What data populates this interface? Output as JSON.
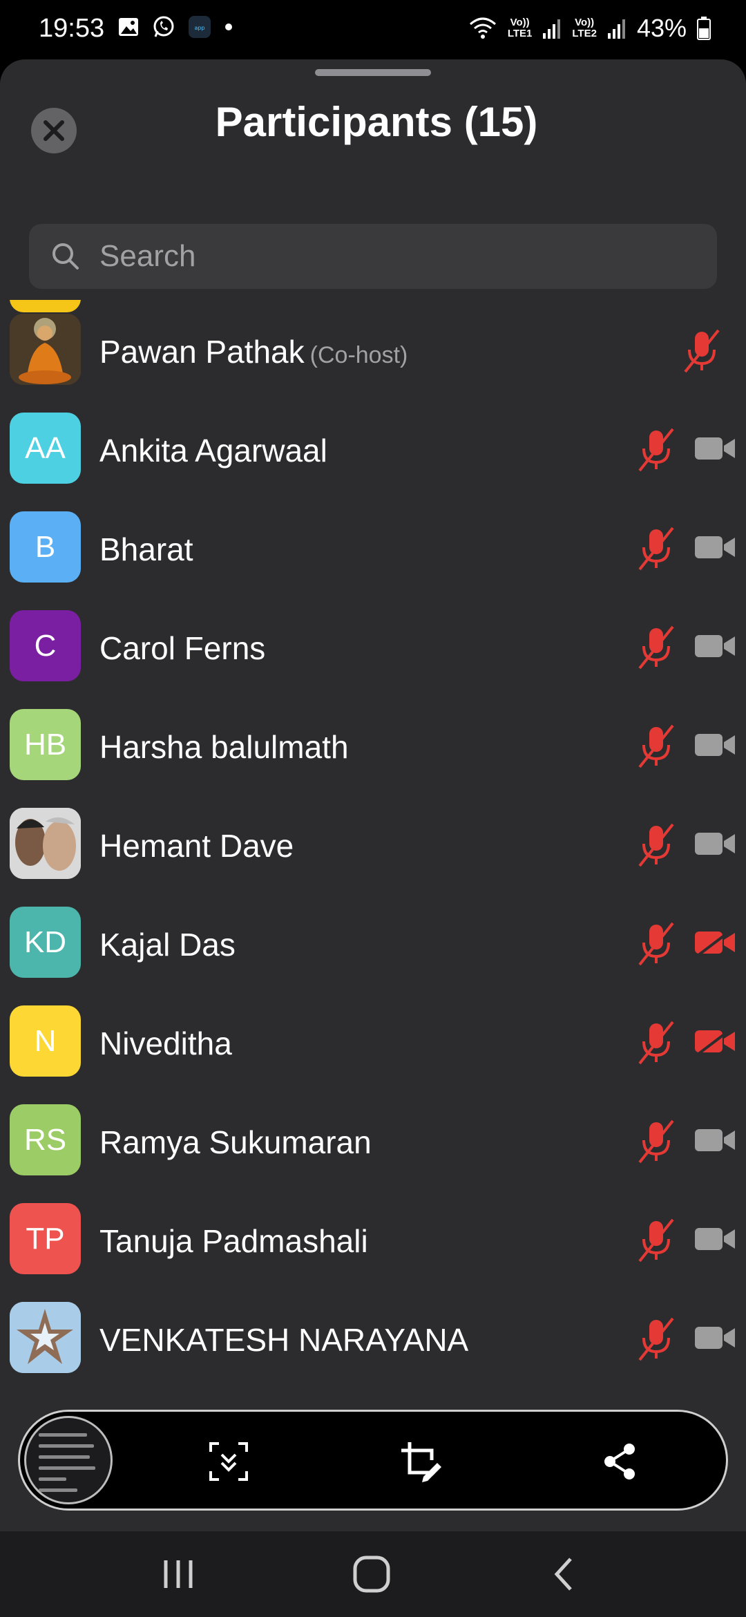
{
  "status_bar": {
    "time": "19:53",
    "battery": "43%",
    "sim1": "LTE1",
    "sim2": "LTE2",
    "volte": "Vo))"
  },
  "header": {
    "title": "Participants (15)"
  },
  "search": {
    "placeholder": "Search"
  },
  "participants": [
    {
      "name": "Pawan Pathak",
      "role": "(Co-host)",
      "avatar": "buddha-photo",
      "muted": true,
      "video": "none"
    },
    {
      "name": "Ankita Agarwaal",
      "initials": "AA",
      "color": "#4dd0e1",
      "muted": true,
      "video": "on"
    },
    {
      "name": "Bharat",
      "initials": "B",
      "color": "#5aaff5",
      "muted": true,
      "video": "on"
    },
    {
      "name": "Carol Ferns",
      "initials": "C",
      "color": "#7b1fa2",
      "muted": true,
      "video": "on"
    },
    {
      "name": "Harsha balulmath",
      "initials": "HB",
      "color": "#a5d67a",
      "muted": true,
      "video": "on"
    },
    {
      "name": "Hemant Dave",
      "avatar": "portrait-photo",
      "muted": true,
      "video": "on"
    },
    {
      "name": "Kajal Das",
      "initials": "KD",
      "color": "#4db6ac",
      "muted": true,
      "video": "off"
    },
    {
      "name": "Niveditha",
      "initials": "N",
      "color": "#fdd835",
      "muted": true,
      "video": "off"
    },
    {
      "name": "Ramya Sukumaran",
      "initials": "RS",
      "color": "#9ccc65",
      "muted": true,
      "video": "on"
    },
    {
      "name": "Tanuja Padmashali",
      "initials": "TP",
      "color": "#ef5350",
      "muted": true,
      "video": "on"
    },
    {
      "name": "VENKATESH NARAYANA",
      "avatar": "star-hands-photo",
      "muted": true,
      "video": "on"
    }
  ],
  "colors": {
    "sheet_bg": "#2c2c2e",
    "muted_red": "#e53935",
    "cam_gray": "#9e9e9e"
  },
  "icons": [
    "close-icon",
    "search-icon",
    "mic-off-icon",
    "camera-icon",
    "camera-off-icon",
    "scroll-capture-icon",
    "crop-edit-icon",
    "share-icon",
    "recents-icon",
    "home-icon",
    "back-icon"
  ]
}
